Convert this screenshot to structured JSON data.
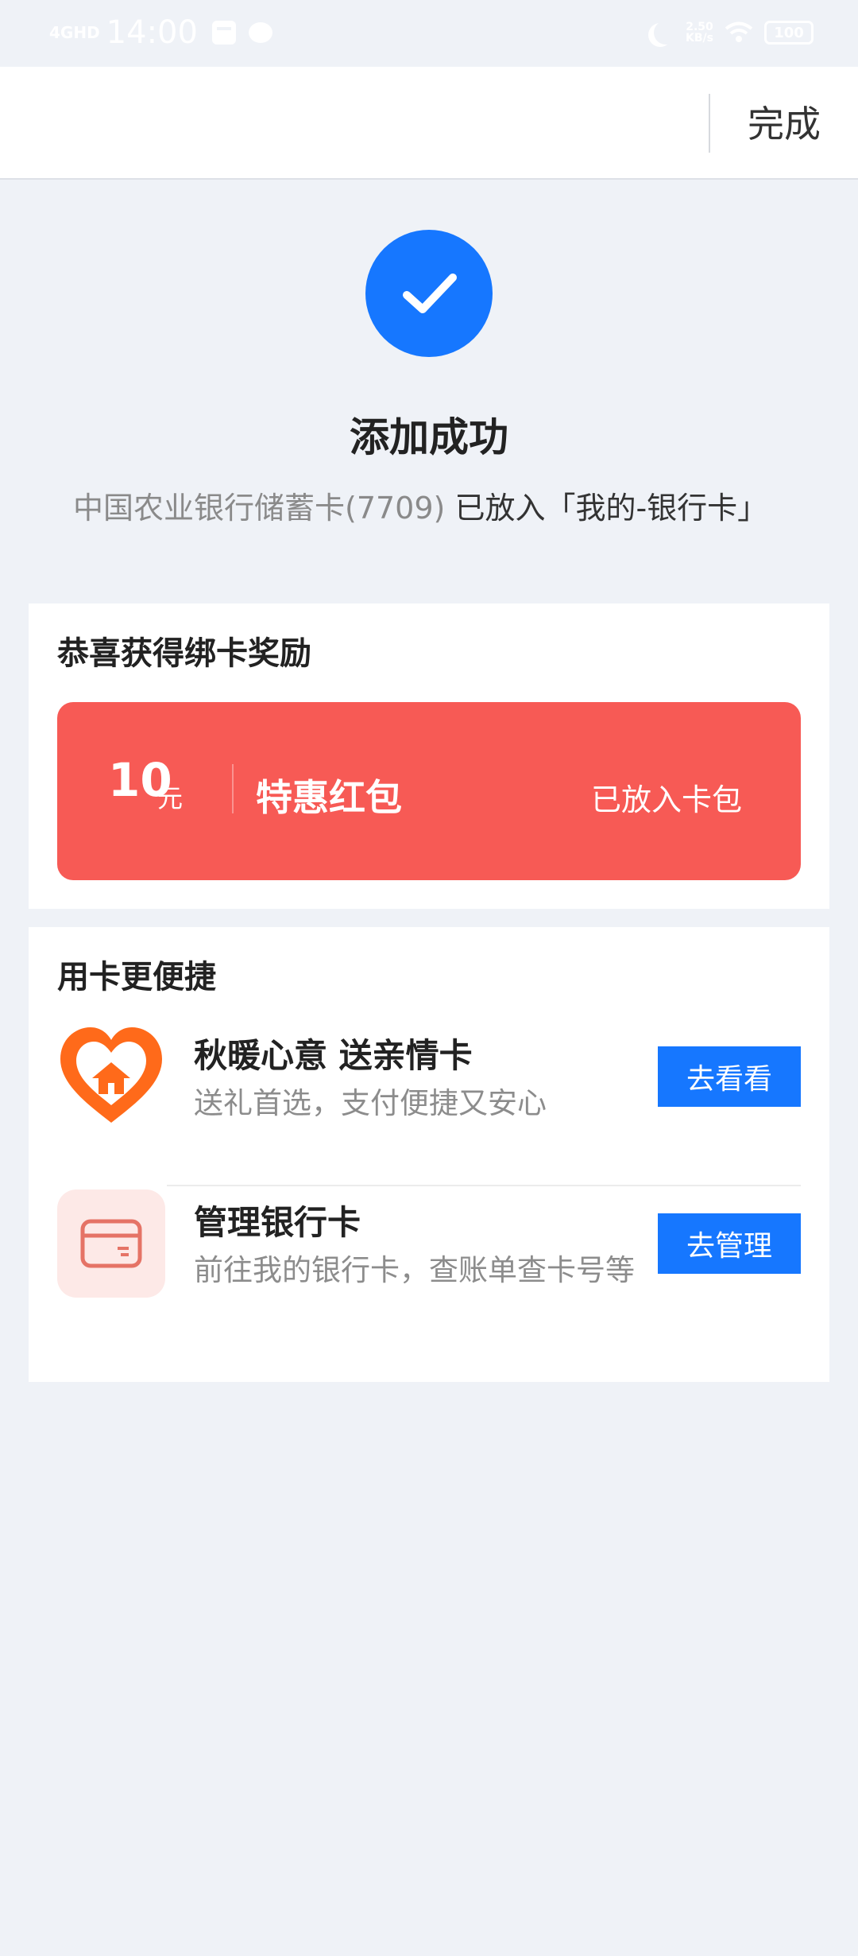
{
  "status_bar": {
    "signal": "4GHD",
    "time": "14:00",
    "speed_value": "2.50",
    "speed_unit": "KB/s",
    "battery": "100"
  },
  "nav": {
    "done_label": "完成"
  },
  "success": {
    "title": "添加成功",
    "card_name": "中国农业银行储蓄卡(7709)",
    "placed_text": "已放入「我的-银行卡」"
  },
  "reward": {
    "title": "恭喜获得绑卡奖励",
    "amount": "10",
    "unit": "元",
    "name": "特惠红包",
    "status": "已放入卡包"
  },
  "convenience": {
    "title": "用卡更便捷",
    "items": [
      {
        "title": "秋暖心意 送亲情卡",
        "subtitle": "送礼首选，支付便捷又安心",
        "button": "去看看",
        "icon": "heart-house-icon"
      },
      {
        "title": "管理银行卡",
        "subtitle": "前往我的银行卡，查账单查卡号等",
        "button": "去管理",
        "icon": "bank-card-icon"
      }
    ]
  },
  "colors": {
    "primary": "#1677ff",
    "coupon": "#f75a55",
    "background": "#eff2f7",
    "heart_orange": "#ff6a1a"
  }
}
